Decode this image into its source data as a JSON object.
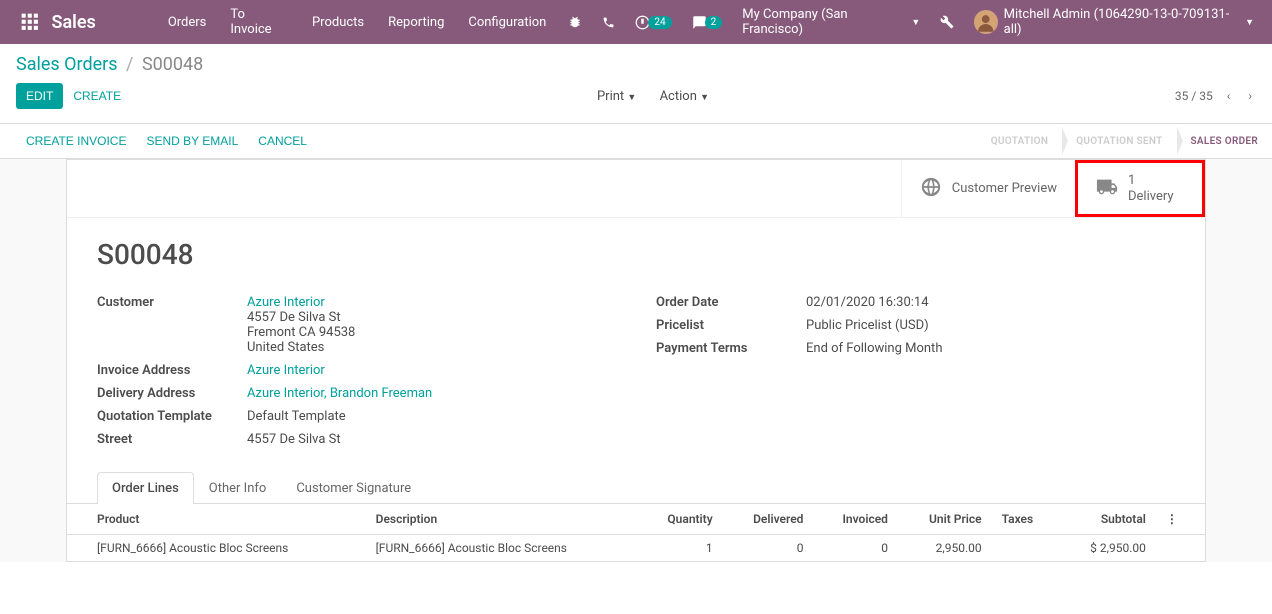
{
  "navbar": {
    "brand": "Sales",
    "links": [
      "Orders",
      "To Invoice",
      "Products",
      "Reporting",
      "Configuration"
    ],
    "debug_badge": "24",
    "chat_badge": "2",
    "company": "My Company (San Francisco)",
    "user": "Mitchell Admin (1064290-13-0-709131-all)"
  },
  "breadcrumb": {
    "parent": "Sales Orders",
    "sep": "/",
    "current": "S00048"
  },
  "control": {
    "edit": "EDIT",
    "create": "CREATE",
    "print": "Print",
    "action": "Action",
    "pager": "35 / 35"
  },
  "statusbar": {
    "create_invoice": "CREATE INVOICE",
    "send_email": "SEND BY EMAIL",
    "cancel": "CANCEL",
    "stages": [
      "QUOTATION",
      "QUOTATION SENT",
      "SALES ORDER"
    ]
  },
  "stat_buttons": {
    "preview_label": "Customer Preview",
    "delivery_value": "1",
    "delivery_label": "Delivery"
  },
  "record": {
    "name": "S00048",
    "left": {
      "customer_label": "Customer",
      "customer_link": "Azure Interior",
      "customer_addr1": "4557 De Silva St",
      "customer_addr2": "Fremont CA 94538",
      "customer_addr3": "United States",
      "invoice_label": "Invoice Address",
      "invoice_link": "Azure Interior",
      "delivery_label": "Delivery Address",
      "delivery_link": "Azure Interior, Brandon Freeman",
      "template_label": "Quotation Template",
      "template_value": "Default Template",
      "street_label": "Street",
      "street_value": "4557 De Silva St"
    },
    "right": {
      "order_date_label": "Order Date",
      "order_date_value": "02/01/2020 16:30:14",
      "pricelist_label": "Pricelist",
      "pricelist_value": "Public Pricelist (USD)",
      "payment_terms_label": "Payment Terms",
      "payment_terms_value": "End of Following Month"
    }
  },
  "tabs": [
    "Order Lines",
    "Other Info",
    "Customer Signature"
  ],
  "order_lines": {
    "headers": {
      "product": "Product",
      "description": "Description",
      "quantity": "Quantity",
      "delivered": "Delivered",
      "invoiced": "Invoiced",
      "unit_price": "Unit Price",
      "taxes": "Taxes",
      "subtotal": "Subtotal"
    },
    "rows": [
      {
        "product": "[FURN_6666] Acoustic Bloc Screens",
        "description": "[FURN_6666] Acoustic Bloc Screens",
        "quantity": "1",
        "delivered": "0",
        "invoiced": "0",
        "unit_price": "2,950.00",
        "taxes": "",
        "subtotal": "$ 2,950.00"
      }
    ]
  }
}
